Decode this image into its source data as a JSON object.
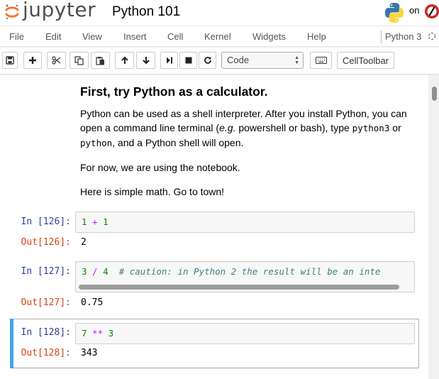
{
  "header": {
    "logo_text": "jupyter",
    "notebook_title": "Python 101",
    "trusted_label": "on"
  },
  "menu": {
    "items": [
      "File",
      "Edit",
      "View",
      "Insert",
      "Cell",
      "Kernel",
      "Widgets",
      "Help"
    ],
    "kernel_name": "Python 3"
  },
  "toolbar": {
    "cell_type": "Code",
    "celltoolbar_label": "CellToolbar",
    "icons": [
      "save-icon",
      "add-cell-icon",
      "cut-icon",
      "copy-icon",
      "paste-icon",
      "move-up-icon",
      "move-down-icon",
      "run-icon",
      "stop-icon",
      "restart-icon",
      "keyboard-icon"
    ]
  },
  "markdown": {
    "heading": "First, try Python as a calculator.",
    "p1_a": "Python can be used as a shell interpreter. After you install Python, you can open a command line terminal (",
    "p1_em": "e.g.",
    "p1_b": " powershell or bash), type ",
    "p1_code1": "python3",
    "p1_c": " or ",
    "p1_code2": "python",
    "p1_d": ", and a Python shell will open.",
    "p2": "For now, we are using the notebook.",
    "p3": "Here is simple math. Go to town!"
  },
  "cells": [
    {
      "in_prompt": "In [126]:",
      "code": {
        "a": "1",
        "op": " + ",
        "b": "1"
      },
      "out_prompt": "Out[126]:",
      "output": "2"
    },
    {
      "in_prompt": "In [127]:",
      "code": {
        "a": "3",
        "op": " / ",
        "b": "4",
        "comment": "  # caution: in Python 2 the result will be an inte"
      },
      "out_prompt": "Out[127]:",
      "output": "0.75"
    },
    {
      "in_prompt": "In [128]:",
      "code": {
        "a": "7",
        "op": " ** ",
        "b": "3"
      },
      "out_prompt": "Out[128]:",
      "output": "343"
    }
  ],
  "colors": {
    "prompt_in": "#303f9f",
    "prompt_out": "#d84315",
    "selected_cell_bar": "#42a5f5",
    "jupyter_orange": "#f37726"
  }
}
